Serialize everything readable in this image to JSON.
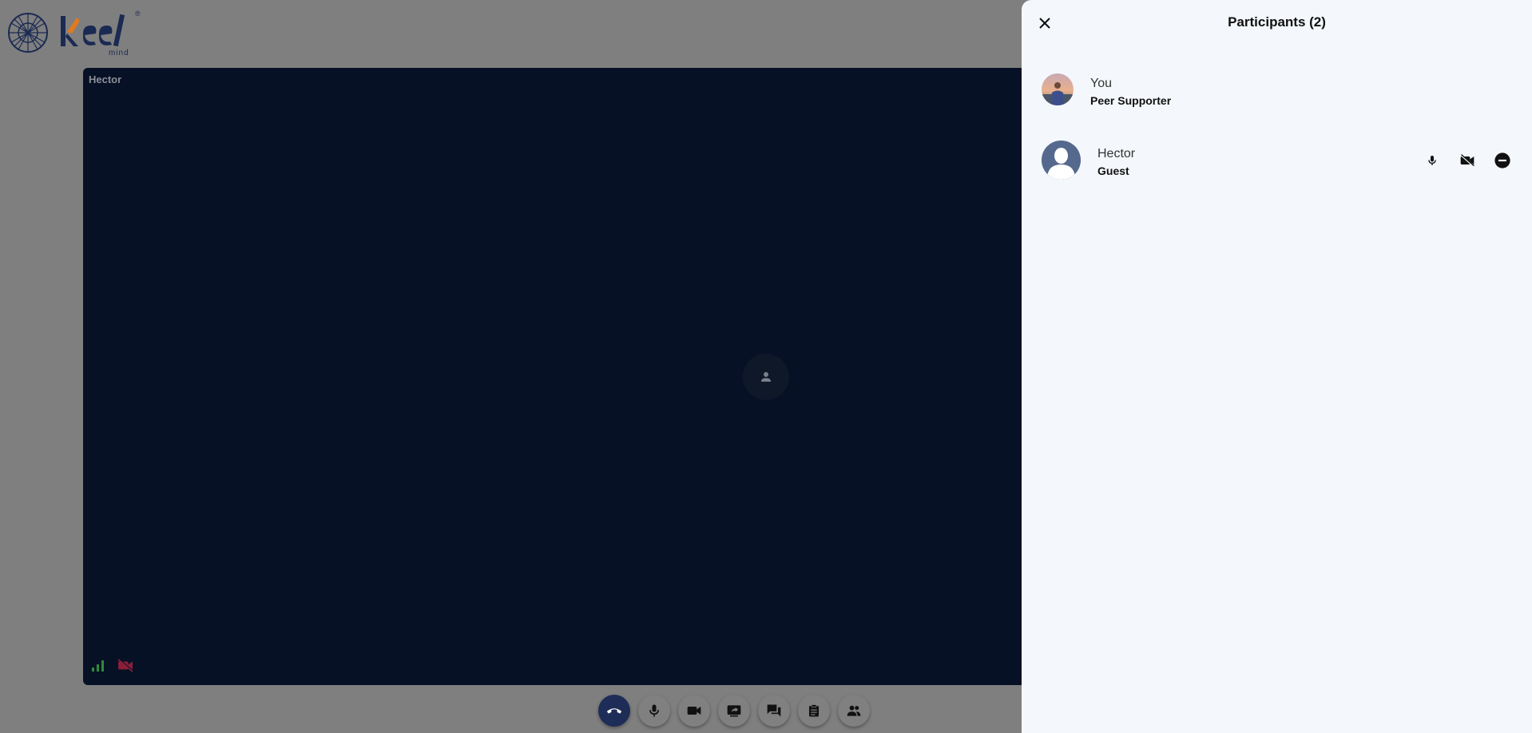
{
  "video": {
    "tile_name": "Hector"
  },
  "toolbar": {
    "buttons": [
      {
        "icon": "end-call-icon"
      },
      {
        "icon": "mic-icon"
      },
      {
        "icon": "video-camera-icon"
      },
      {
        "icon": "screen-share-icon"
      },
      {
        "icon": "chat-icon"
      },
      {
        "icon": "clipboard-icon"
      },
      {
        "icon": "participants-icon"
      }
    ]
  },
  "participants_panel": {
    "title": "Participants (2)",
    "participants": [
      {
        "name": "You",
        "role": "Peer Supporter"
      },
      {
        "name": "Hector",
        "role": "Guest"
      }
    ]
  },
  "colors": {
    "backdrop": "#7f7f7f",
    "video_bg": "#071125",
    "panel_bg": "#f4f7fb",
    "end_call": "#1e2d57",
    "signal_green": "#2e8b3a",
    "camera_off_red": "#8b1f3a",
    "brand_navy": "#1b2a52",
    "brand_orange": "#e07a1f"
  }
}
